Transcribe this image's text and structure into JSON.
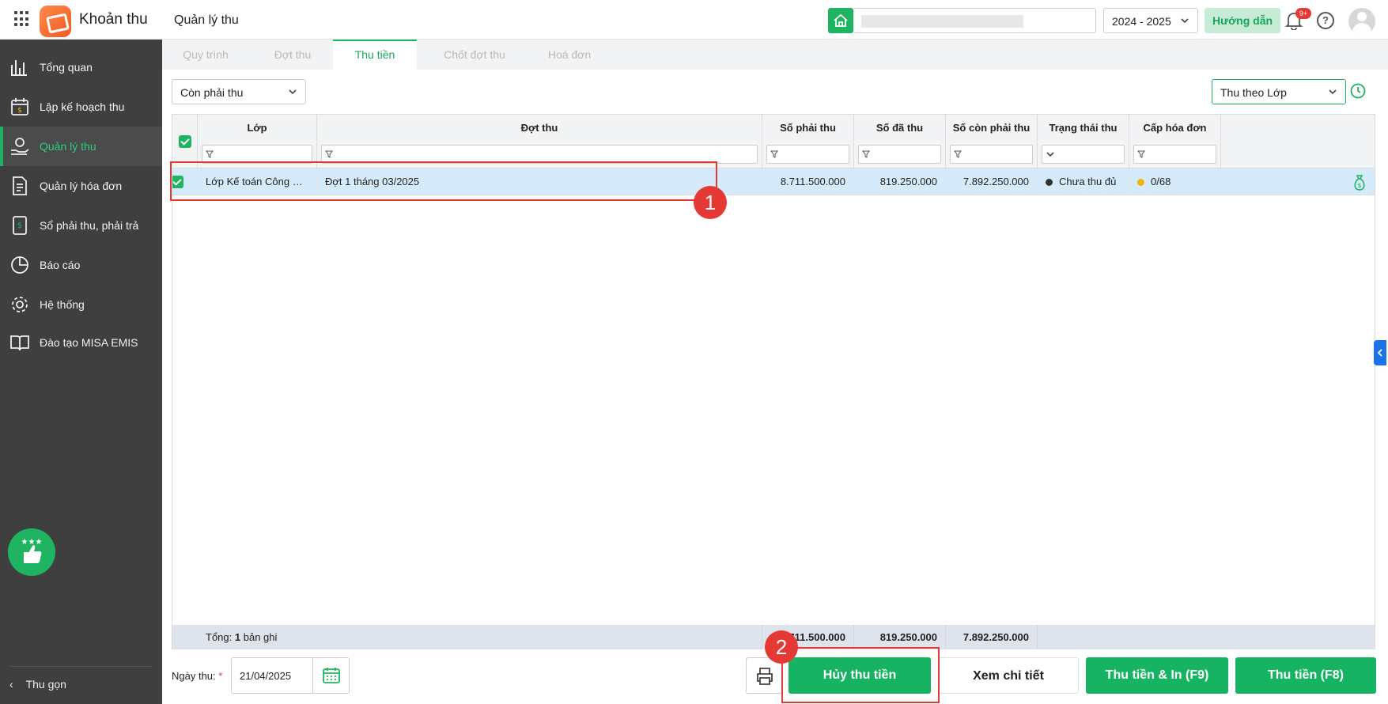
{
  "app": {
    "name": "Khoản thu",
    "page_title": "Quản lý thu"
  },
  "header": {
    "school_year": "2024 - 2025",
    "guide_label": "Hướng dẫn",
    "notification_count": "9+"
  },
  "sidebar": {
    "items": [
      {
        "label": "Tổng quan",
        "icon": "bar-chart-icon"
      },
      {
        "label": "Lập kế hoạch thu",
        "icon": "calendar-money-icon"
      },
      {
        "label": "Quản lý thu",
        "icon": "hand-coin-icon",
        "active": true
      },
      {
        "label": "Quản lý hóa đơn",
        "icon": "invoice-icon"
      },
      {
        "label": "Sổ phải thu, phải trả",
        "icon": "ledger-icon"
      },
      {
        "label": "Báo cáo",
        "icon": "pie-chart-icon"
      },
      {
        "label": "Hệ thống",
        "icon": "gear-icon"
      },
      {
        "label": "Đào tạo MISA EMIS",
        "icon": "book-icon"
      }
    ],
    "collapse_label": "Thu gọn"
  },
  "tabs": [
    {
      "label": "Quy trình"
    },
    {
      "label": "Đợt thu"
    },
    {
      "label": "Thu tiền",
      "active": true
    },
    {
      "label": "Chốt đợt thu"
    },
    {
      "label": "Hoá đơn"
    }
  ],
  "filters": {
    "status": "Còn phải thu",
    "collect_by": "Thu theo Lớp"
  },
  "table": {
    "columns": [
      "Lớp",
      "Đợt thu",
      "Số phải thu",
      "Số đã thu",
      "Số còn phải thu",
      "Trạng thái thu",
      "Cấp hóa đơn"
    ],
    "rows": [
      {
        "class": "Lớp Kế toán Công CQ...",
        "period": "Đợt 1 tháng 03/2025",
        "amount_due": "8.711.500.000",
        "amount_paid": "819.250.000",
        "amount_remaining": "7.892.250.000",
        "status": "Chưa thu đủ",
        "invoice": "0/68"
      }
    ],
    "footer": {
      "total_label": "Tổng:",
      "total_count": "1",
      "total_suffix": "bản ghi",
      "amount_due": "8.711.500.000",
      "amount_paid": "819.250.000",
      "amount_remaining": "7.892.250.000"
    }
  },
  "bottom": {
    "date_label": "Ngày thu:",
    "required_mark": "*",
    "date_value": "21/04/2025",
    "cancel_button": "Hủy thu tiền",
    "detail_button": "Xem chi tiết",
    "collect_print_button": "Thu tiền & In (F9)",
    "collect_button": "Thu tiền (F8)"
  },
  "annotations": [
    "1",
    "2"
  ],
  "colors": {
    "accent": "#1fb461",
    "sidebar": "#3f3f3f",
    "selected_row": "#d5ebfb",
    "annotation": "#e53935",
    "status_dot": "#333333",
    "invoice_dot": "#f2b600"
  }
}
